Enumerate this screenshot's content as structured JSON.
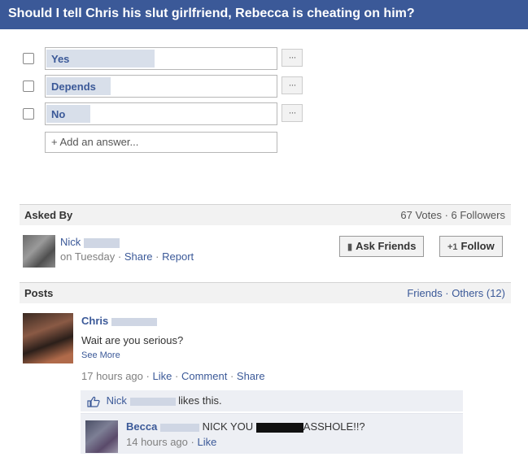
{
  "question": {
    "title": "Should I tell Chris his slut girlfriend, Rebecca is cheating on him?"
  },
  "poll": {
    "options": [
      {
        "label": "Yes",
        "more": "···",
        "bar_fraction": 0.47
      },
      {
        "label": "Depends",
        "more": "···",
        "bar_fraction": 0.28
      },
      {
        "label": "No",
        "more": "···",
        "bar_fraction": 0.19
      }
    ],
    "add_answer": "+ Add an answer..."
  },
  "asked_by": {
    "title": "Asked By",
    "stats": "67 Votes · 6 Followers",
    "asker_name": "Nick",
    "asker_when": "on Tuesday",
    "share": "Share",
    "report": "Report",
    "sep": "·",
    "ask_friends": "Ask Friends",
    "follow": "Follow",
    "follow_icon": "+1"
  },
  "posts": {
    "title": "Posts",
    "filters": "Friends · Others (12)",
    "post": {
      "author": "Chris",
      "text": "Wait are you serious?",
      "see_more": "See More",
      "time": "17 hours ago",
      "like": "Like",
      "comment": "Comment",
      "share": "Share",
      "sep": "·",
      "likes_user": "Nick",
      "likes_text": "likes this.",
      "comment_item": {
        "author": "Becca",
        "text_before": "NICK YOU",
        "text_after": "ASSHOLE!!?",
        "time": "14 hours ago",
        "like": "Like",
        "sep": "·"
      }
    }
  },
  "colors": {
    "header_bg": "#3b5998",
    "link": "#3b5998",
    "poll_bar": "#d8dfea",
    "section_bg": "#f2f2f2",
    "comment_bg": "#edeff4"
  }
}
